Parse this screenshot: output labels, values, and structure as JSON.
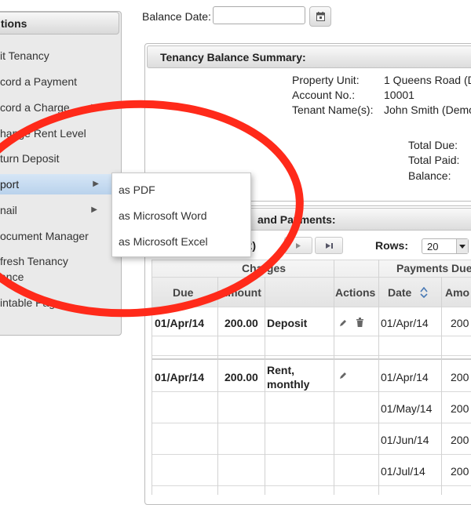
{
  "sidebar": {
    "header": "tions",
    "items": [
      {
        "label": "it Tenancy"
      },
      {
        "label": "cord a Payment"
      },
      {
        "label": "cord a Charge"
      },
      {
        "label": "hange Rent Level"
      },
      {
        "label": "turn Deposit"
      },
      {
        "label": "port"
      },
      {
        "label": "nail"
      },
      {
        "label": "ocument Manager"
      },
      {
        "label": "fresh Tenancy"
      },
      {
        "label": "ance"
      },
      {
        "label": "intable Page"
      }
    ]
  },
  "submenu": {
    "items": [
      {
        "label": "as PDF"
      },
      {
        "label": "as Microsoft Word"
      },
      {
        "label": "as Microsoft Excel"
      }
    ]
  },
  "balance_date": {
    "label": "Balance Date:",
    "value": ""
  },
  "summary": {
    "title": "Tenancy Balance Summary:",
    "property_unit_label": "Property Unit:",
    "property_unit_value": "1 Queens Road (D",
    "account_no_label": "Account No.:",
    "account_no_value": "10001",
    "tenant_label": "Tenant Name(s):",
    "tenant_value": "John Smith (Demo",
    "total_due_label": "Total Due:",
    "total_paid_label": "Total Paid:",
    "balance_label": "Balance:"
  },
  "ledger": {
    "title": "and Payments:",
    "page_info": "f 2)",
    "rows_label": "Rows:",
    "rows_value": "20",
    "group_charges": "Charges",
    "group_payments": "Payments Due",
    "col_due": "Due",
    "col_amount": "Amount",
    "col_actions": "Actions",
    "col_date": "Date",
    "col_amount2": "Amo",
    "rows": [
      {
        "due": "01/Apr/14",
        "amount": "200.00",
        "desc": "Deposit",
        "date": "01/Apr/14",
        "amt": "200"
      },
      {
        "due": "01/Apr/14",
        "amount": "200.00",
        "desc1": "Rent,",
        "desc2": "monthly",
        "date": "01/Apr/14",
        "amt": "200"
      },
      {
        "date": "01/May/14",
        "amt": "200"
      },
      {
        "date": "01/Jun/14",
        "amt": "200"
      },
      {
        "date": "01/Jul/14",
        "amt": "200"
      }
    ]
  },
  "colors": {
    "highlight": "#c6dcf2",
    "annotation": "#ff2a1a"
  }
}
